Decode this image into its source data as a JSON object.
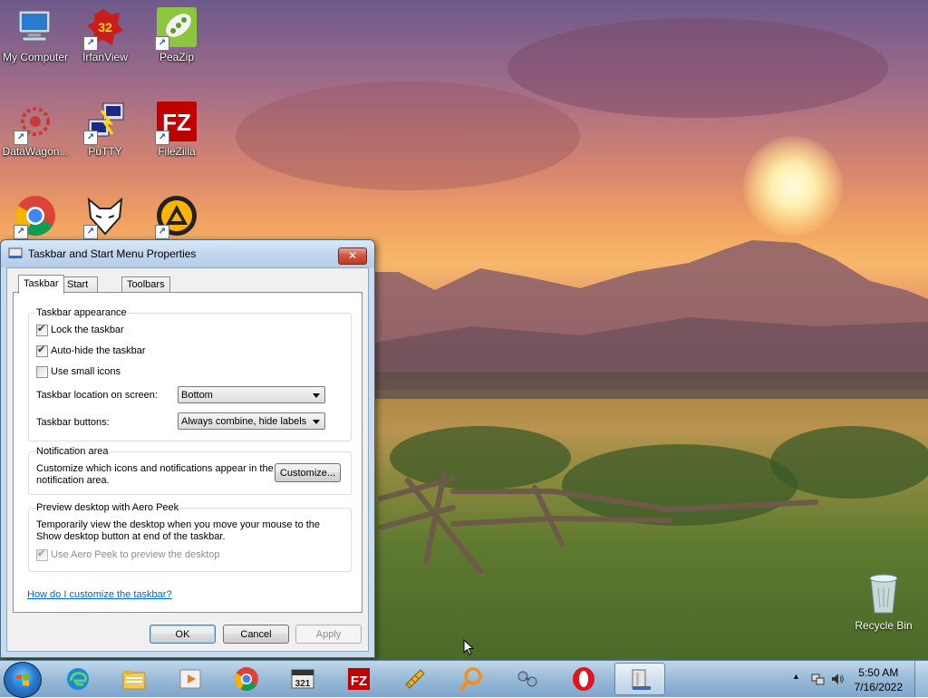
{
  "desktop_icons": [
    {
      "label": "My Computer",
      "icon": "computer-icon",
      "shortcut": false
    },
    {
      "label": "IrfanView",
      "icon": "irfanview-icon",
      "badge": "32",
      "shortcut": true
    },
    {
      "label": "PeaZip",
      "icon": "peazip-icon",
      "shortcut": true
    },
    {
      "label": "DataWagon...",
      "icon": "datawagon-icon",
      "shortcut": true
    },
    {
      "label": "PuTTY",
      "icon": "putty-icon",
      "shortcut": true
    },
    {
      "label": "FileZilla",
      "icon": "filezilla-icon",
      "badge": "FZ",
      "shortcut": true
    },
    {
      "label": "",
      "icon": "chrome-icon",
      "shortcut": true
    },
    {
      "label": "",
      "icon": "foobar-icon",
      "shortcut": true
    },
    {
      "label": "",
      "icon": "aimp-icon",
      "shortcut": true
    }
  ],
  "recycle_bin": {
    "label": "Recycle Bin"
  },
  "dialog": {
    "title": "Taskbar and Start Menu Properties",
    "close_glyph": "✕",
    "tabs": [
      "Taskbar",
      "Start Menu",
      "Toolbars"
    ],
    "active_tab": "Taskbar",
    "appearance": {
      "title": "Taskbar appearance",
      "lock": {
        "label": "Lock the taskbar",
        "checked": true
      },
      "autohide": {
        "label": "Auto-hide the taskbar",
        "checked": true
      },
      "small_icons": {
        "label": "Use small icons",
        "checked": false
      },
      "location_label": "Taskbar location on screen:",
      "location_value": "Bottom",
      "buttons_label": "Taskbar buttons:",
      "buttons_value": "Always combine, hide labels"
    },
    "notification": {
      "title": "Notification area",
      "text_line1": "Customize which icons and notifications appear in the",
      "text_line2": "notification area.",
      "customize_label": "Customize..."
    },
    "aero_peek": {
      "title": "Preview desktop with Aero Peek",
      "text_line1": "Temporarily view the desktop when you move your mouse to the",
      "text_line2": "Show desktop button at end of the taskbar.",
      "checkbox_label": "Use Aero Peek to preview the desktop",
      "checked": true,
      "disabled": true
    },
    "help_link": "How do I customize the taskbar?",
    "ok_label": "OK",
    "cancel_label": "Cancel",
    "apply_label": "Apply"
  },
  "taskbar": {
    "pinned": [
      "edge-icon",
      "explorer-icon",
      "media-player-icon",
      "chrome-icon",
      "mpc-hc-icon",
      "filezilla-icon",
      "sandbox-icon",
      "search-tool-icon",
      "network-tool-icon",
      "opera-icon",
      "properties-window-icon"
    ],
    "time": "5:50 AM",
    "date": "7/16/2022"
  },
  "colors": {
    "accent": "#3c7fb1",
    "link": "#0066cc",
    "close": "#c03a22"
  }
}
